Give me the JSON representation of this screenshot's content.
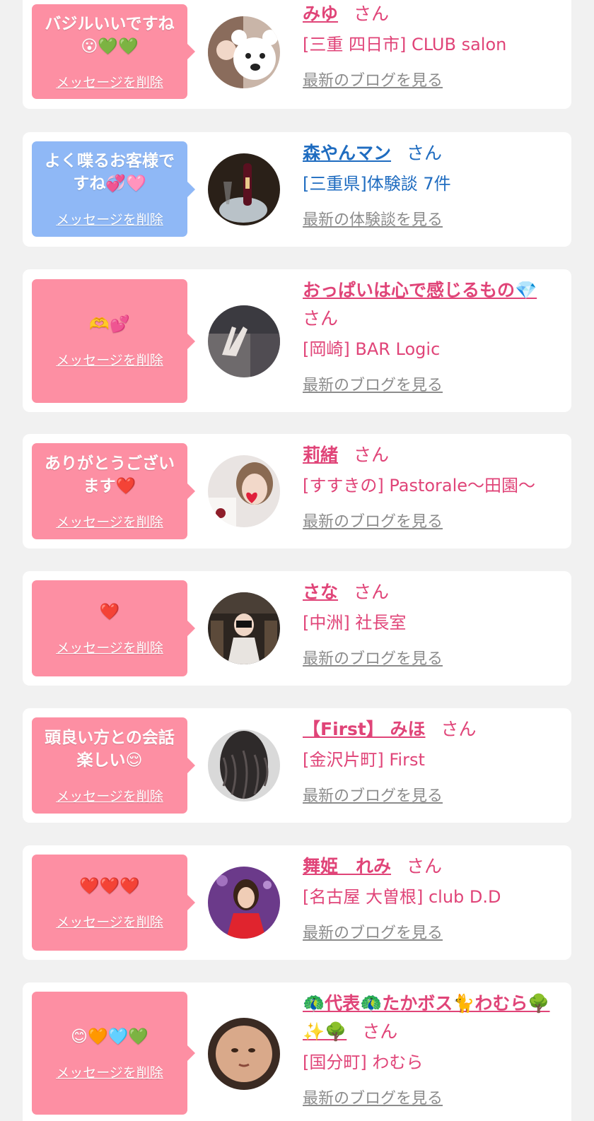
{
  "delete_label": "メッセージを削除",
  "honorific": "さん",
  "colors": {
    "pink_bubble": "#fd8fa3",
    "blue_bubble": "#8fb8f6",
    "name_pink": "#e04478",
    "name_blue": "#1f6cc0",
    "link_gray": "#8c8c8c"
  },
  "entries": [
    {
      "message": "バジルいいですね\n😮💚💚",
      "name": "みゆ",
      "shop": "[三重 四日市] CLUB salon",
      "link": "最新のブログを見る"
    },
    {
      "message": "よく喋るお客様で\nすね💞🩷",
      "name": "森やんマン",
      "shop": "[三重県]体験談 7件",
      "link": "最新の体験談を見る"
    },
    {
      "message": "🫶💕",
      "name": "おっぱいは心で感じるもの💎",
      "shop": "[岡崎] BAR Logic",
      "link": "最新のブログを見る"
    },
    {
      "message": "ありがとうござい\nます❤️",
      "name": "莉緒",
      "shop": "[すすきの] Pastorale〜田園〜",
      "link": "最新のブログを見る"
    },
    {
      "message": "❤️",
      "name": "さな",
      "shop": "[中洲] 社長室",
      "link": "最新のブログを見る"
    },
    {
      "message": "頭良い方との会話\n楽しい😌",
      "name": "【First】 みほ",
      "shop": "[金沢片町] First",
      "link": "最新のブログを見る"
    },
    {
      "message": "❤️❤️❤️",
      "name": "舞姫　れみ",
      "shop": "[名古屋 大曽根] club D.D",
      "link": "最新のブログを見る"
    },
    {
      "message": "😊🧡🩵💚",
      "name": "🦚代表🦚たかボス🐈わむら🌳✨🌳",
      "shop": "[国分町] わむら",
      "link": "最新のブログを見る"
    }
  ],
  "avatars": [
    "photo of woman with white bear emoji",
    "champagne bottle",
    "hand making peace sign",
    "woman with heart sticker",
    "woman with blurred face",
    "long wavy dark hair",
    "woman in red dress",
    "face in round frame"
  ]
}
